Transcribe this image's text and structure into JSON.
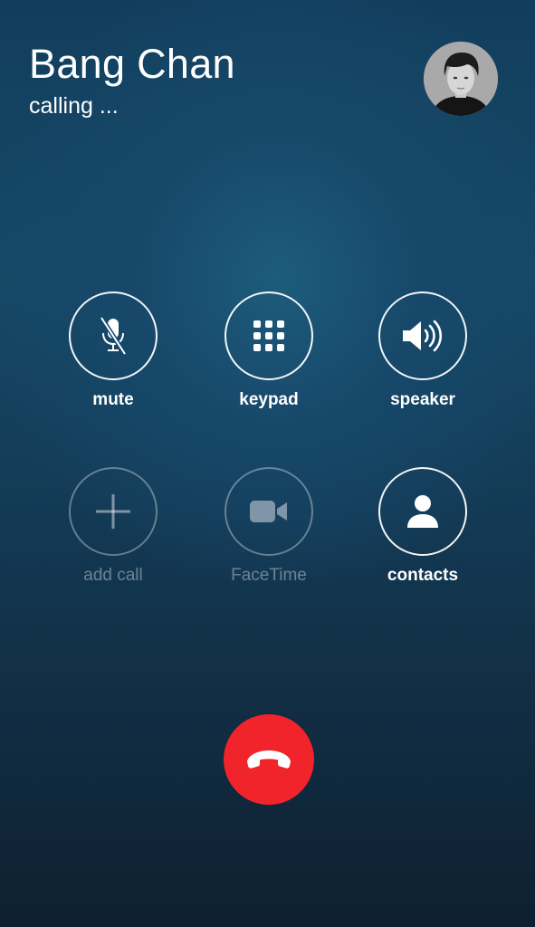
{
  "caller": {
    "name": "Bang Chan",
    "status": "calling ..."
  },
  "controls": [
    {
      "label": "mute",
      "icon": "muted-microphone-icon",
      "enabled": true
    },
    {
      "label": "keypad",
      "icon": "keypad-icon",
      "enabled": true
    },
    {
      "label": "speaker",
      "icon": "speaker-icon",
      "enabled": true
    },
    {
      "label": "add call",
      "icon": "plus-icon",
      "enabled": false
    },
    {
      "label": "FaceTime",
      "icon": "video-camera-icon",
      "enabled": false
    },
    {
      "label": "contacts",
      "icon": "person-icon",
      "enabled": true
    }
  ],
  "end_call": {
    "icon": "phone-hangup-icon",
    "color": "#f0242a"
  },
  "colors": {
    "background": "#164866",
    "end_call": "#f0242a",
    "text": "#ffffff"
  }
}
